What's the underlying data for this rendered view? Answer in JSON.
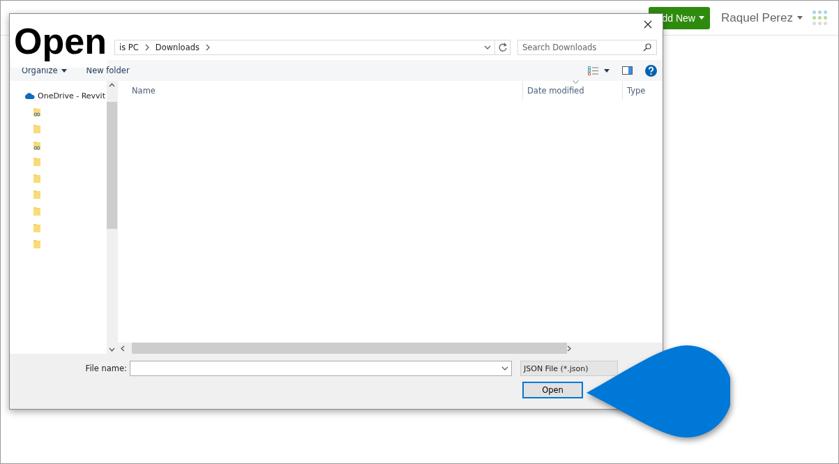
{
  "app_header": {
    "add_button": "dd New",
    "user": "Raquel Perez"
  },
  "dialog": {
    "breadcrumb": [
      "is PC",
      "Downloads"
    ],
    "search": {
      "placeholder": "Search Downloads"
    },
    "toolbar": [
      {
        "label": "Organize",
        "kind": "menu"
      },
      {
        "label": "New folder",
        "kind": "button"
      }
    ],
    "nav_items": [
      {
        "label": "OneDrive - Revvit",
        "kind": "cloud"
      },
      {
        "kind": "shared-folder"
      },
      {
        "kind": "folder"
      },
      {
        "kind": "shared-folder"
      },
      {
        "kind": "folder"
      },
      {
        "kind": "folder"
      },
      {
        "kind": "folder"
      },
      {
        "kind": "folder"
      },
      {
        "kind": "folder"
      },
      {
        "kind": "folder"
      }
    ],
    "columns": [
      {
        "label": "Name",
        "sorted": false
      },
      {
        "label": "Date modified",
        "sorted": true
      },
      {
        "label": "Type",
        "sorted": false
      }
    ],
    "file_name": {
      "label": "File name:"
    },
    "file_type": "JSON File (*.json)",
    "buttons": [
      "Open"
    ]
  },
  "annotation": {
    "label": "Open"
  }
}
